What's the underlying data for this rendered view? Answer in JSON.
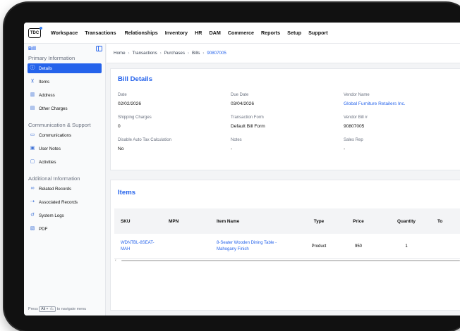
{
  "topnav": {
    "logo_text": "TDC",
    "items": [
      "Workspace",
      "Transactions",
      "Relationships",
      "Inventory",
      "HR",
      "DAM",
      "Commerce",
      "Reports",
      "Setup",
      "Support"
    ]
  },
  "sidebar": {
    "title": "Bill",
    "sections": [
      {
        "label": "Primary Information",
        "items": [
          {
            "label": "Details",
            "icon": "info-icon",
            "active": true
          },
          {
            "label": "Items",
            "icon": "cart-icon",
            "active": false
          },
          {
            "label": "Address",
            "icon": "map-icon",
            "active": false
          },
          {
            "label": "Other Charges",
            "icon": "charges-icon",
            "active": false
          }
        ]
      },
      {
        "label": "Communication & Support",
        "items": [
          {
            "label": "Communications",
            "icon": "chat-icon",
            "active": false
          },
          {
            "label": "User Notes",
            "icon": "note-icon",
            "active": false
          },
          {
            "label": "Activities",
            "icon": "activity-icon",
            "active": false
          }
        ]
      },
      {
        "label": "Additional Information",
        "items": [
          {
            "label": "Related Records",
            "icon": "link-icon",
            "active": false
          },
          {
            "label": "Associated Records",
            "icon": "associate-icon",
            "active": false
          },
          {
            "label": "System Logs",
            "icon": "history-icon",
            "active": false
          },
          {
            "label": "PDF",
            "icon": "pdf-icon",
            "active": false
          }
        ]
      }
    ],
    "footer": {
      "prefix": "Press",
      "keys": "Alt + ↑/↓",
      "suffix": "to navigate menu"
    }
  },
  "breadcrumb": [
    "Home",
    "Transactions",
    "Purchases",
    "Bills",
    "90807005"
  ],
  "bill_details": {
    "title": "Bill Details",
    "fields": [
      {
        "label": "Date",
        "value": "02/02/2026"
      },
      {
        "label": "Due Date",
        "value": "03/04/2026"
      },
      {
        "label": "Vendor Name",
        "value": "Global Furniture Retailers Inc."
      },
      {
        "label": "Shipping Charges",
        "value": "0"
      },
      {
        "label": "Transaction Form",
        "value": "Default Bill Form"
      },
      {
        "label": "Vendor Bill #",
        "value": "90807005"
      },
      {
        "label": "Disable Auto Tax Calculation",
        "value": "No"
      },
      {
        "label": "Notes",
        "value": "-"
      },
      {
        "label": "Sales Rep",
        "value": "-"
      }
    ]
  },
  "items": {
    "title": "Items",
    "columns": [
      "SKU",
      "MPN",
      "Item Name",
      "Type",
      "Price",
      "Quantity",
      "To"
    ],
    "rows": [
      {
        "sku_line1": "WDNTBL-8SEAT-",
        "sku_line2": "MAH",
        "mpn": "",
        "name_line1": "8-Seater Wooden Dining Table -",
        "name_line2": "Mahogany Finish",
        "type": "Product",
        "price": "950",
        "quantity": "1",
        "total": ""
      }
    ]
  },
  "colors": {
    "accent": "#2563eb",
    "background": "#f3f4f6"
  }
}
